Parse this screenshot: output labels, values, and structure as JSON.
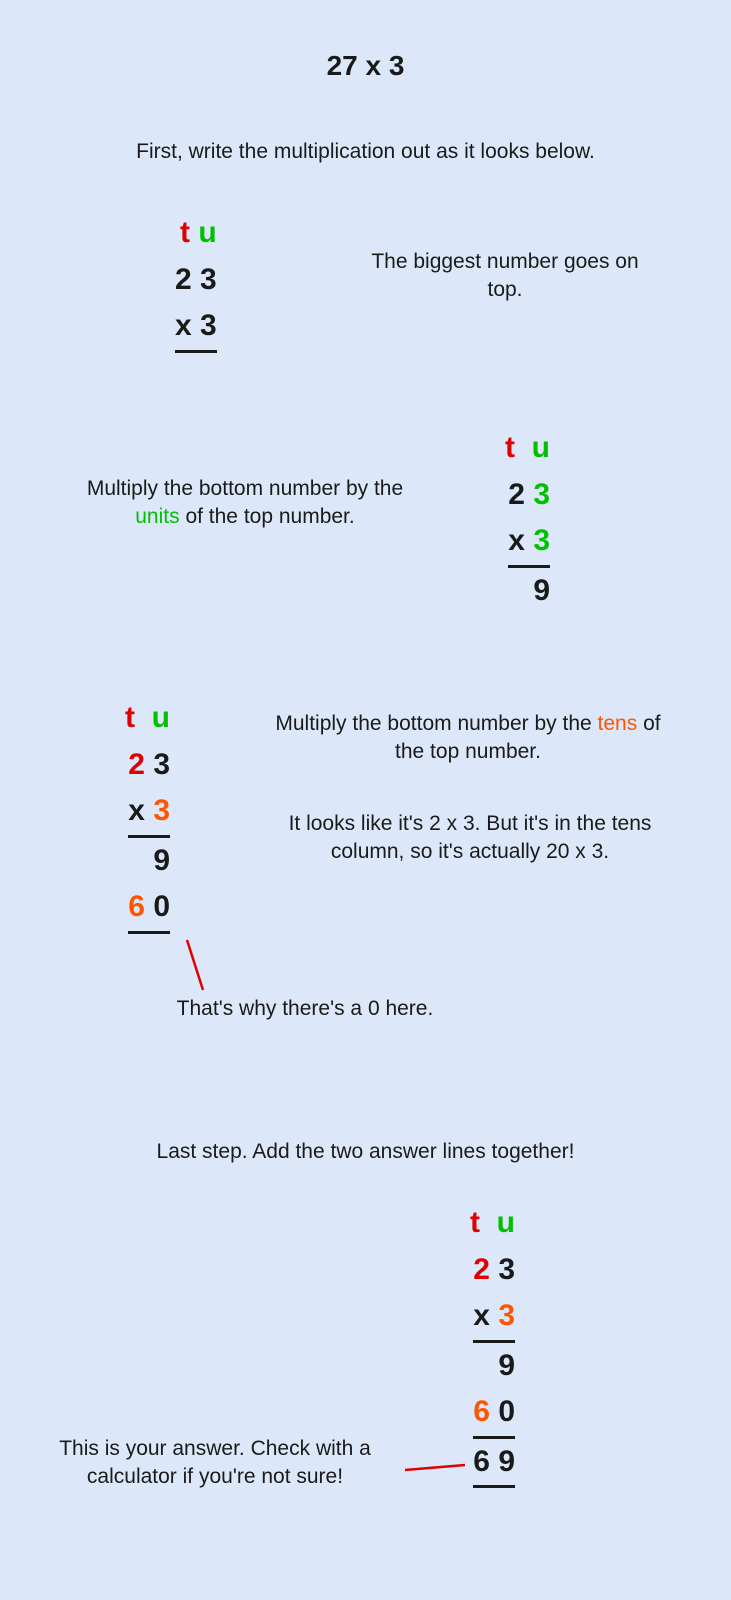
{
  "title": "27 x 3",
  "step1_instruction": "First, write the multiplication out as it looks below.",
  "step1_caption": "The biggest number goes on top.",
  "labels": {
    "t": "t",
    "u": "u"
  },
  "digits": {
    "d2": "2",
    "d3": "3",
    "d9": "9",
    "d6": "6",
    "d0": "0",
    "x": "x"
  },
  "step2_text_pre": "Multiply the bottom number by the ",
  "step2_units": "units",
  "step2_text_post": " of the top number.",
  "step3_text_pre": "Multiply the bottom number by the ",
  "step3_tens": "tens",
  "step3_text_post": " of the top number.",
  "step3_hint": "It looks like it's 2 x 3. But it's in the tens column, so it's actually 20 x 3.",
  "step3_zero": "That's why there's a 0 here.",
  "step4_instruction": "Last step. Add the two answer lines together!",
  "step4_answer": "This is your answer. Check with a calculator if you're not sure!"
}
